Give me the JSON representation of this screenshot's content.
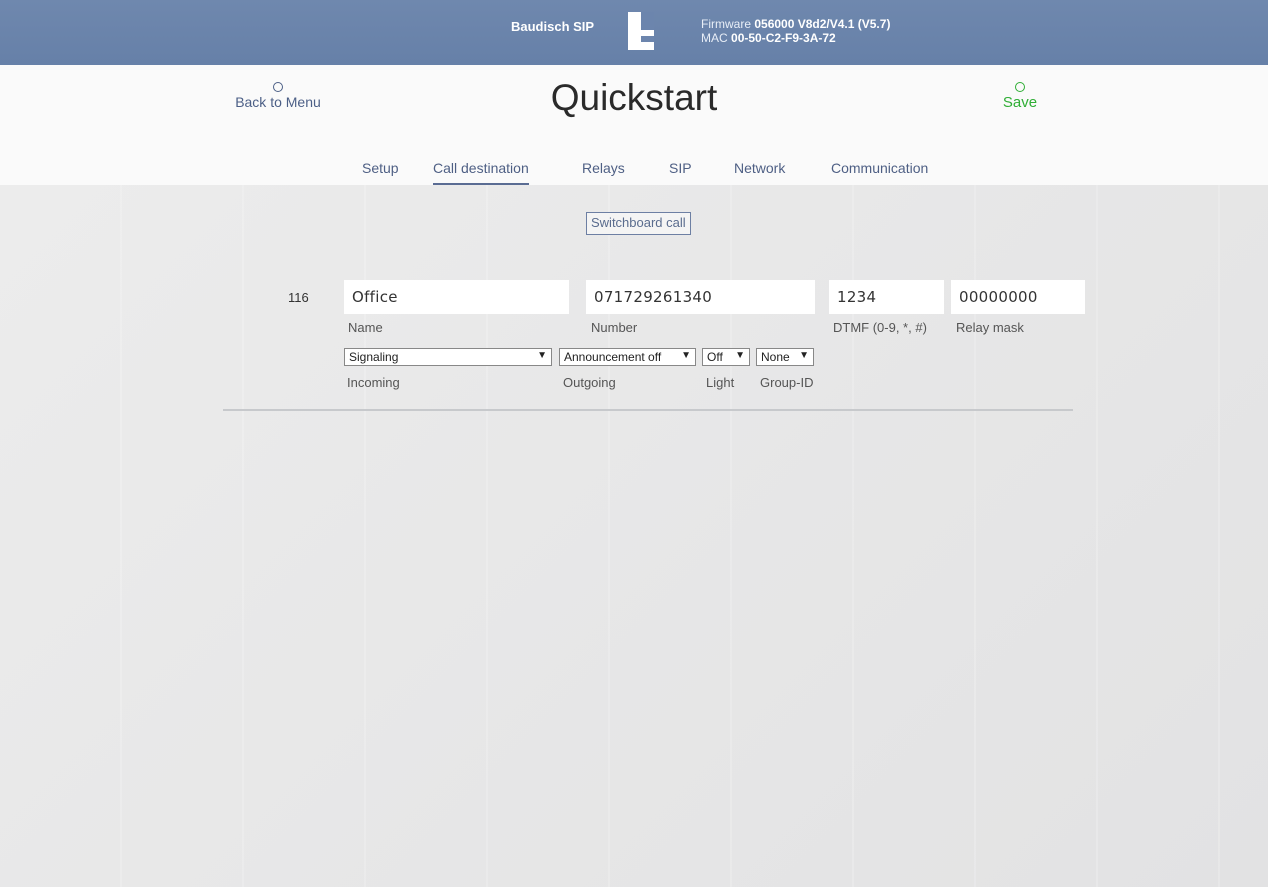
{
  "topbar": {
    "brand": "Baudisch SIP",
    "firmware_label": "Firmware",
    "firmware_value": "056000 V8d2/V4.1 (V5.7)",
    "mac_label": "MAC",
    "mac_value": "00-50-C2-F9-3A-72"
  },
  "header": {
    "back_label": "Back to Menu",
    "title": "Quickstart",
    "save_label": "Save"
  },
  "tabs": [
    {
      "label": "Setup"
    },
    {
      "label": "Call destination"
    },
    {
      "label": "Relays"
    },
    {
      "label": "SIP"
    },
    {
      "label": "Network"
    },
    {
      "label": "Communication"
    }
  ],
  "active_tab": "Call destination",
  "switchboard_button": "Switchboard call",
  "entry": {
    "number": "116",
    "name_value": "Office",
    "name_label": "Name",
    "phone_value": "071729261340",
    "phone_label": "Number",
    "dtmf_value": "1234",
    "dtmf_label": "DTMF (0-9, *, #)",
    "relay_value": "00000000",
    "relay_label": "Relay mask",
    "incoming_value": "Signaling",
    "incoming_label": "Incoming",
    "outgoing_value": "Announcement off",
    "outgoing_label": "Outgoing",
    "light_value": "Off",
    "light_label": "Light",
    "group_value": "None",
    "group_label": "Group-ID"
  },
  "colors": {
    "topbar": "#6a83ab",
    "save": "#2fae35",
    "link": "#4e5f84"
  }
}
